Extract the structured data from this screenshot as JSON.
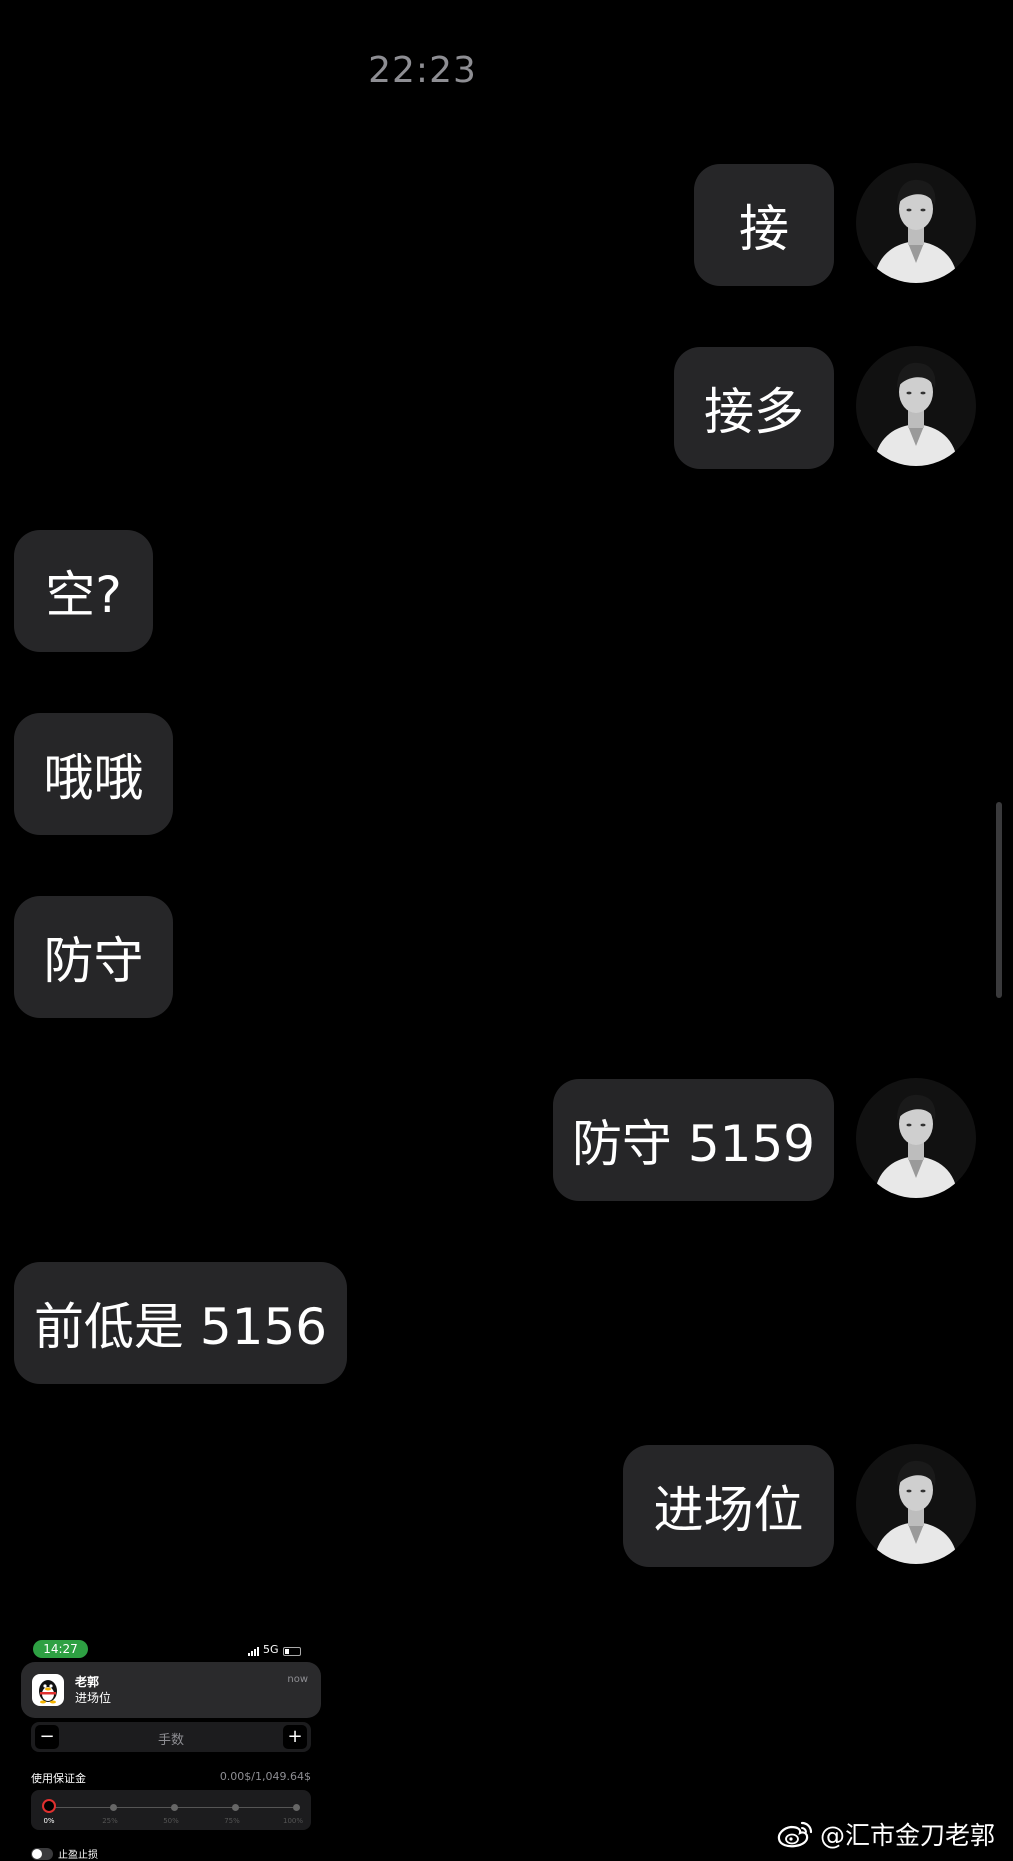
{
  "chat": {
    "timestamp": "22:23",
    "messages": [
      {
        "side": "right",
        "text": "接"
      },
      {
        "side": "right",
        "text": "接多"
      },
      {
        "side": "left",
        "text": "空?"
      },
      {
        "side": "left",
        "text": "哦哦"
      },
      {
        "side": "left",
        "text": "防守"
      },
      {
        "side": "right",
        "text": "防守 5159"
      },
      {
        "side": "left",
        "text": "前低是 5156"
      },
      {
        "side": "right",
        "text": "进场位"
      }
    ]
  },
  "embedded_screenshot": {
    "status_time": "14:27",
    "network": "5G",
    "notification": {
      "sender": "老郭",
      "message": "进场位",
      "time": "now",
      "app_icon": "qq-penguin-icon"
    },
    "lots_stepper": {
      "minus": "−",
      "label": "手数",
      "plus": "+"
    },
    "margin": {
      "label": "使用保证金",
      "value": "0.00$/1,049.64$",
      "slider_fraction": 0,
      "ticks": [
        "0%",
        "25%",
        "50%",
        "75%",
        "100%"
      ]
    },
    "toggle_label": "止盈止损"
  },
  "watermark": {
    "text": "@汇市金刀老郭",
    "icon": "weibo-icon"
  },
  "colors": {
    "background": "#000000",
    "bubble": "#262628",
    "timestamp": "#8e8e93",
    "status_green": "#2ea043",
    "slider_knob": "#e0302f"
  }
}
